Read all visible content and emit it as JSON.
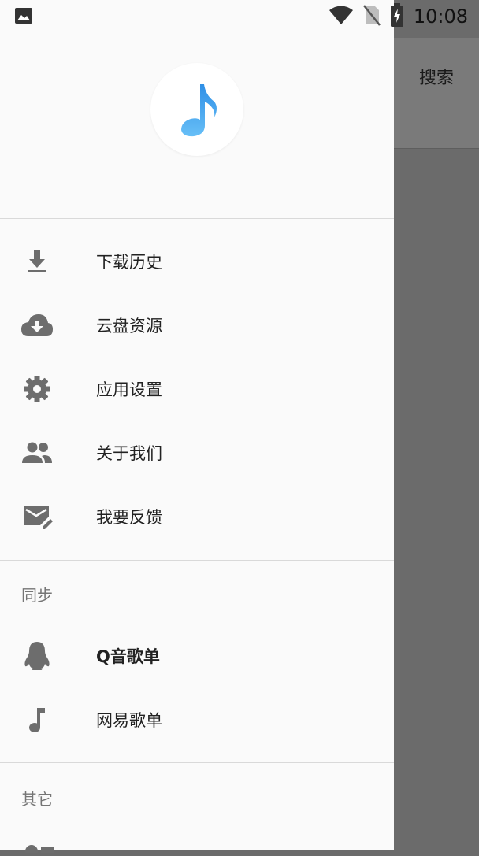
{
  "status_bar": {
    "time": "10:08"
  },
  "background": {
    "search_label": "搜索"
  },
  "drawer": {
    "main_items": [
      {
        "label": "下载历史",
        "icon": "download-icon"
      },
      {
        "label": "云盘资源",
        "icon": "cloud-download-icon"
      },
      {
        "label": "应用设置",
        "icon": "gear-icon"
      },
      {
        "label": "关于我们",
        "icon": "people-icon"
      },
      {
        "label": "我要反馈",
        "icon": "mail-edit-icon"
      }
    ],
    "sync_section": {
      "title": "同步",
      "items": [
        {
          "label": "Q音歌单",
          "icon": "qq-penguin-icon"
        },
        {
          "label": "网易歌单",
          "icon": "music-note-icon"
        }
      ]
    },
    "other_section": {
      "title": "其它"
    }
  },
  "colors": {
    "accent": "#3a9ff0",
    "icon": "#6d6d6d",
    "scrim": "#6b6b6b"
  }
}
